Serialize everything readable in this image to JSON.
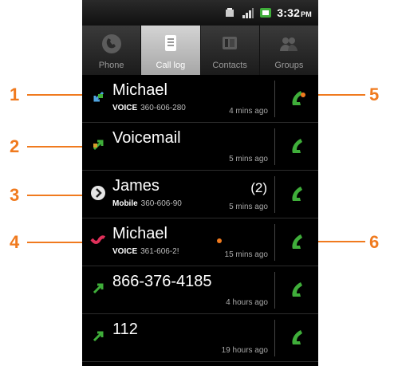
{
  "status": {
    "time": "3:32",
    "ampm": "PM"
  },
  "tabs": [
    {
      "label": "Phone"
    },
    {
      "label": "Call log"
    },
    {
      "label": "Contacts"
    },
    {
      "label": "Groups"
    }
  ],
  "calls": [
    {
      "name": "Michael",
      "type_label": "VOICE",
      "number": "360-606-280",
      "time": "4 mins ago",
      "count": "",
      "icon": "incoming-call-icon"
    },
    {
      "name": "Voicemail",
      "type_label": "",
      "number": "",
      "time": "5 mins ago",
      "count": "",
      "icon": "voicemail-call-icon"
    },
    {
      "name": "James",
      "type_label": "Mobile",
      "number": "360-606-90",
      "time": "5 mins ago",
      "count": "(2)",
      "icon": "expand-arrow-icon"
    },
    {
      "name": "Michael",
      "type_label": "VOICE",
      "number": "361-606-2!",
      "time": "15 mins ago",
      "count": "",
      "icon": "missed-call-icon"
    },
    {
      "name": "866-376-4185",
      "type_label": "",
      "number": "",
      "time": "4 hours ago",
      "count": "",
      "icon": "outgoing-call-icon"
    },
    {
      "name": "112",
      "type_label": "",
      "number": "",
      "time": "19 hours ago",
      "count": "",
      "icon": "outgoing-call-icon"
    }
  ],
  "callouts": [
    "1",
    "2",
    "3",
    "4",
    "5",
    "6"
  ],
  "colors": {
    "accent": "#f07a1e",
    "call_green": "#3fae3a",
    "missed": "#e0305a"
  }
}
